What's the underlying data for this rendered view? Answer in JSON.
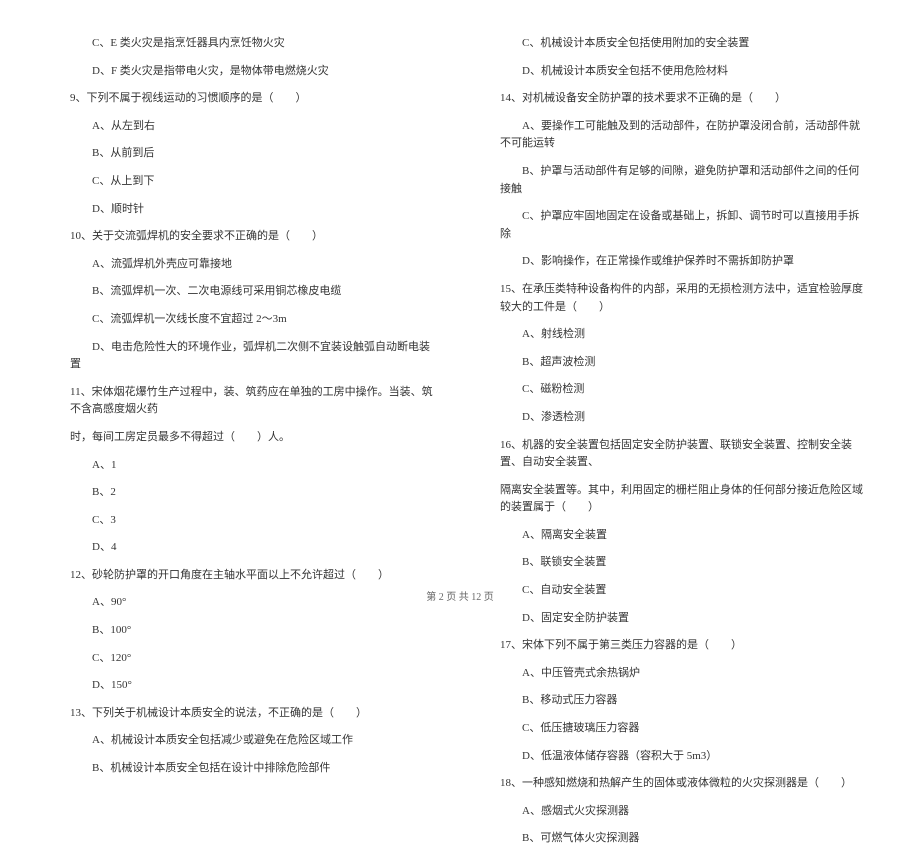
{
  "left_column": [
    {
      "type": "option",
      "text": "C、E 类火灾是指烹饪器具内烹饪物火灾"
    },
    {
      "type": "option",
      "text": "D、F 类火灾是指带电火灾，是物体带电燃烧火灾"
    },
    {
      "type": "question",
      "text": "9、下列不属于视线运动的习惯顺序的是（　　）"
    },
    {
      "type": "option",
      "text": "A、从左到右"
    },
    {
      "type": "option",
      "text": "B、从前到后"
    },
    {
      "type": "option",
      "text": "C、从上到下"
    },
    {
      "type": "option",
      "text": "D、顺时针"
    },
    {
      "type": "question",
      "text": "10、关于交流弧焊机的安全要求不正确的是（　　）"
    },
    {
      "type": "option",
      "text": "A、流弧焊机外壳应可靠接地"
    },
    {
      "type": "option",
      "text": "B、流弧焊机一次、二次电源线可采用铜芯橡皮电缆"
    },
    {
      "type": "option",
      "text": "C、流弧焊机一次线长度不宜超过 2～3m"
    },
    {
      "type": "option",
      "text": "D、电击危险性大的环境作业，弧焊机二次侧不宜装设触弧自动断电装置"
    },
    {
      "type": "question",
      "text": "11、宋体烟花爆竹生产过程中，装、筑药应在单独的工房中操作。当装、筑不含高感度烟火药"
    },
    {
      "type": "question-cont",
      "text": "时，每间工房定员最多不得超过（　　）人。"
    },
    {
      "type": "option",
      "text": "A、1"
    },
    {
      "type": "option",
      "text": "B、2"
    },
    {
      "type": "option",
      "text": "C、3"
    },
    {
      "type": "option",
      "text": "D、4"
    },
    {
      "type": "question",
      "text": "12、砂轮防护罩的开口角度在主轴水平面以上不允许超过（　　）"
    },
    {
      "type": "option",
      "text": "A、90°"
    },
    {
      "type": "option",
      "text": "B、100°"
    },
    {
      "type": "option",
      "text": "C、120°"
    },
    {
      "type": "option",
      "text": "D、150°"
    },
    {
      "type": "question",
      "text": "13、下列关于机械设计本质安全的说法，不正确的是（　　）"
    },
    {
      "type": "option",
      "text": "A、机械设计本质安全包括减少或避免在危险区域工作"
    },
    {
      "type": "option",
      "text": "B、机械设计本质安全包括在设计中排除危险部件"
    }
  ],
  "right_column": [
    {
      "type": "option",
      "text": "C、机械设计本质安全包括使用附加的安全装置"
    },
    {
      "type": "option",
      "text": "D、机械设计本质安全包括不使用危险材料"
    },
    {
      "type": "question",
      "text": "14、对机械设备安全防护罩的技术要求不正确的是（　　）"
    },
    {
      "type": "option",
      "text": "A、要操作工可能触及到的活动部件，在防护罩没闭合前，活动部件就不可能运转"
    },
    {
      "type": "option",
      "text": "B、护罩与活动部件有足够的间隙，避免防护罩和活动部件之间的任何接触"
    },
    {
      "type": "option",
      "text": "C、护罩应牢固地固定在设备或基础上，拆卸、调节时可以直接用手拆除"
    },
    {
      "type": "option",
      "text": "D、影响操作，在正常操作或维护保养时不需拆卸防护罩"
    },
    {
      "type": "question",
      "text": "15、在承压类特种设备构件的内部，采用的无损检测方法中，适宜检验厚度较大的工件是（　　）"
    },
    {
      "type": "option",
      "text": "A、射线检测"
    },
    {
      "type": "option",
      "text": "B、超声波检测"
    },
    {
      "type": "option",
      "text": "C、磁粉检测"
    },
    {
      "type": "option",
      "text": "D、渗透检测"
    },
    {
      "type": "question",
      "text": "16、机器的安全装置包括固定安全防护装置、联锁安全装置、控制安全装置、自动安全装置、"
    },
    {
      "type": "question-cont",
      "text": "隔离安全装置等。其中，利用固定的栅栏阻止身体的任何部分接近危险区域的装置属于（　　）"
    },
    {
      "type": "option",
      "text": "A、隔离安全装置"
    },
    {
      "type": "option",
      "text": "B、联锁安全装置"
    },
    {
      "type": "option",
      "text": "C、自动安全装置"
    },
    {
      "type": "option",
      "text": "D、固定安全防护装置"
    },
    {
      "type": "question",
      "text": "17、宋体下列不属于第三类压力容器的是（　　）"
    },
    {
      "type": "option",
      "text": "A、中压管壳式余热锅炉"
    },
    {
      "type": "option",
      "text": "B、移动式压力容器"
    },
    {
      "type": "option",
      "text": "C、低压搪玻璃压力容器"
    },
    {
      "type": "option",
      "text": "D、低温液体储存容器（容积大于 5m3）"
    },
    {
      "type": "question",
      "text": "18、一种感知燃烧和热解产生的固体或液体微粒的火灾探测器是（　　）"
    },
    {
      "type": "option",
      "text": "A、感烟式火灾探测器"
    },
    {
      "type": "option",
      "text": "B、可燃气体火灾探测器"
    }
  ],
  "footer": "第 2 页 共 12 页"
}
